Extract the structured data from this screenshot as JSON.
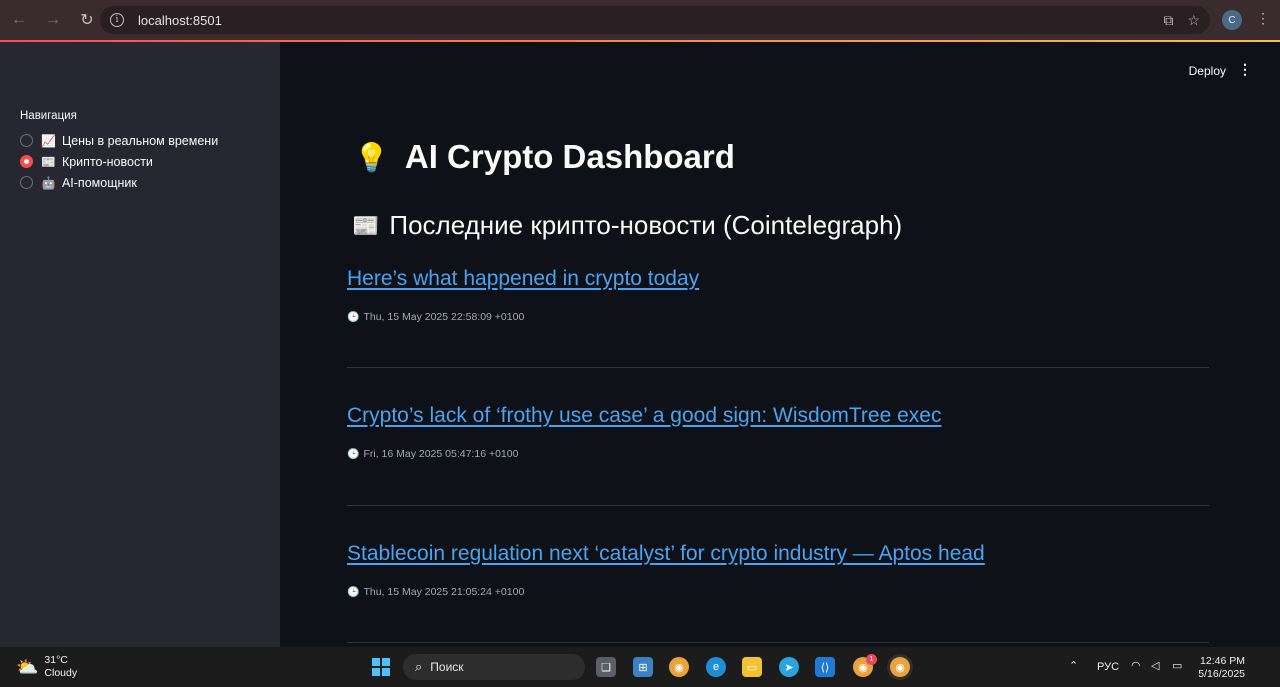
{
  "browser": {
    "url": "localhost:8501",
    "profile_initial": "C"
  },
  "sidebar": {
    "title": "Навигация",
    "items": [
      {
        "icon": "📈",
        "label": "Цены в реальном времени",
        "selected": false
      },
      {
        "icon": "📰",
        "label": "Крипто-новости",
        "selected": true
      },
      {
        "icon": "🤖",
        "label": "AI-помощник",
        "selected": false
      }
    ]
  },
  "header": {
    "deploy_label": "Deploy"
  },
  "main": {
    "title_icon": "💡",
    "title": "AI Crypto Dashboard",
    "subtitle_icon": "📰",
    "subtitle": "Последние крипто-новости (Cointelegraph)",
    "articles": [
      {
        "title": "Here’s what happened in crypto today",
        "date": "Thu, 15 May 2025 22:58:09 +0100"
      },
      {
        "title": "Crypto’s lack of ‘frothy use case’ a good sign: WisdomTree exec",
        "date": "Fri, 16 May 2025 05:47:16 +0100"
      },
      {
        "title": "Stablecoin regulation next ‘catalyst’ for crypto industry — Aptos head",
        "date": "Thu, 15 May 2025 21:05:24 +0100"
      }
    ]
  },
  "taskbar": {
    "weather_temp": "31°C",
    "weather_desc": "Cloudy",
    "search_label": "Поиск",
    "language": "РУС",
    "time": "12:46 PM",
    "date": "5/16/2025",
    "chrome_badge": "1"
  },
  "colors": {
    "accent": "#ff4b4b",
    "link": "#4aa3f0",
    "sidebar_bg": "#262730",
    "main_bg": "#0e1117"
  }
}
